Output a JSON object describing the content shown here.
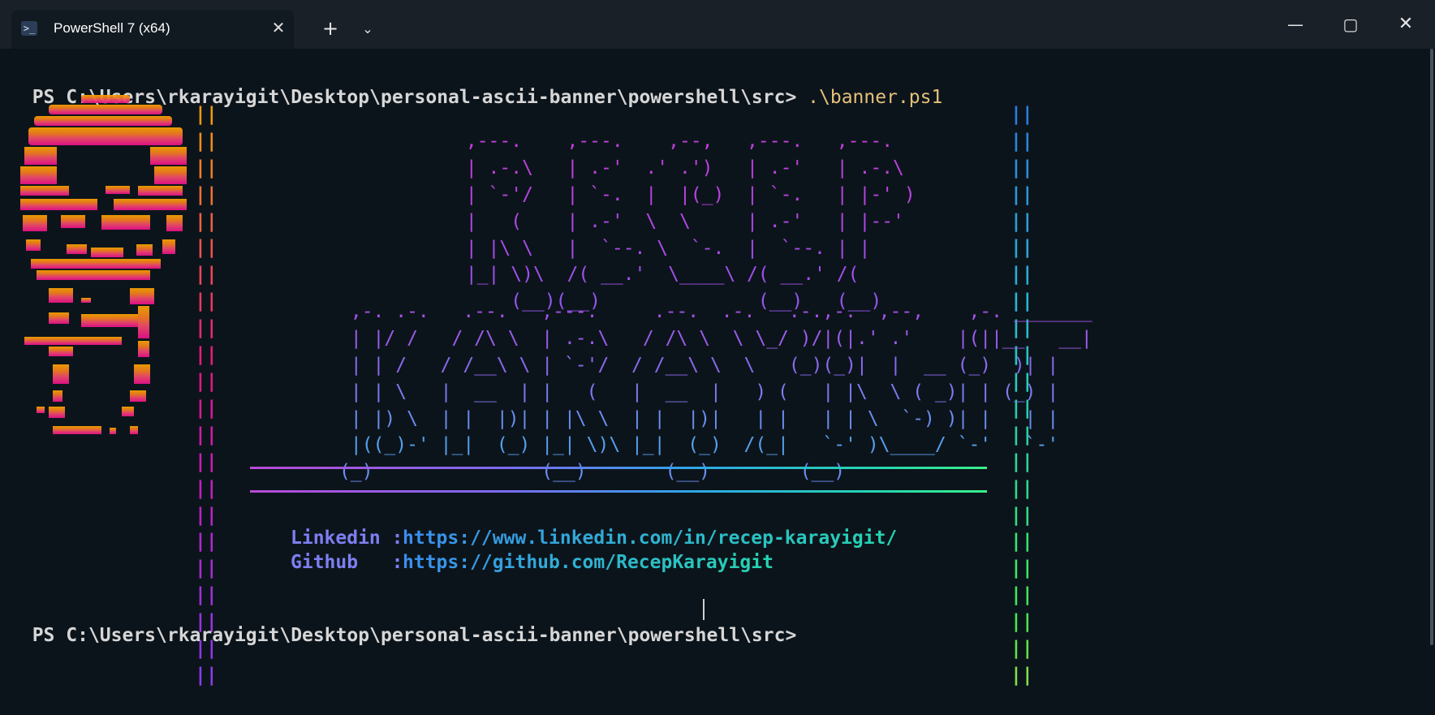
{
  "tab": {
    "title": "PowerShell 7 (x64)",
    "icon": "powershell-icon",
    "close_glyph": "✕",
    "new_tab_glyph": "+",
    "dropdown_glyph": "⌄"
  },
  "window_controls": {
    "minimize": "—",
    "maximize": "▢",
    "close": "✕"
  },
  "terminal": {
    "prompt": "PS C:\\Users\\rkarayigit\\Desktop\\personal-ascii-banner\\powershell\\src>",
    "command": ".\\banner.ps1",
    "final_prompt": "PS C:\\Users\\rkarayigit\\Desktop\\personal-ascii-banner\\powershell\\src>"
  },
  "banner": {
    "border": "||",
    "recep_lines": [
      " ,---.    ,---.    ,--,   ,---.   ,---.  ",
      " | .-.\\   | .-'  .' .')   | .-'   | .-.\\ ",
      " | `-'/   | `-.  |  |(_)  | `-.   | |-' )",
      " |   (    | .-'  \\  \\     | .-'   | |--' ",
      " | |\\ \\   |  `--. \\  `-.  |  `--. | |    ",
      " |_| \\)\\  /( __.'  \\____\\ /( __.' /(     ",
      "     (__)(__)              (__)   (__)    "
    ],
    "karayigit_lines": [
      " ,-. .-.   .--.   ,---.     .--.  .-.   .-.,-.  ,--,    ,-. _______ ",
      " | |/ /   / /\\ \\  | .-.\\   / /\\ \\  \\ \\_/ )/|(|.' .'    |(||__   __|",
      " | | /   / /__\\ \\ | `-'/  / /__\\ \\  \\   (_)(_)|  |  __ (_)  )| |   ",
      " | | \\   |  __  | |   (   |  __  |   ) (   | |\\  \\ ( _)| | (_) |   ",
      " | |) \\  | |  |)| | |\\ \\  | |  |)|   | |   | | \\  `-) )| |   | |   ",
      " |((_)-' |_|  (_) |_| \\)\\ |_|  (_)  /(_|   `-' )\\____/ `-'   `-'   ",
      "(_)               (__)       (__)        (__)                       "
    ],
    "linkedin_label": "Linkedin :",
    "linkedin_url": "https://www.linkedin.com/in/recep-karayigit/",
    "github_label": "Github   :",
    "github_url": "https://github.com/RecepKarayigit"
  },
  "colors": {
    "background": "#0c141b",
    "titlebar": "#1a2027",
    "prompt": "#d6d6d6",
    "command": "#e5c07b",
    "recep_gradient": [
      "#c83ee0",
      "#9a56f0"
    ],
    "karayigit_gradient": [
      "#a455f0",
      "#3cc8e8"
    ]
  }
}
